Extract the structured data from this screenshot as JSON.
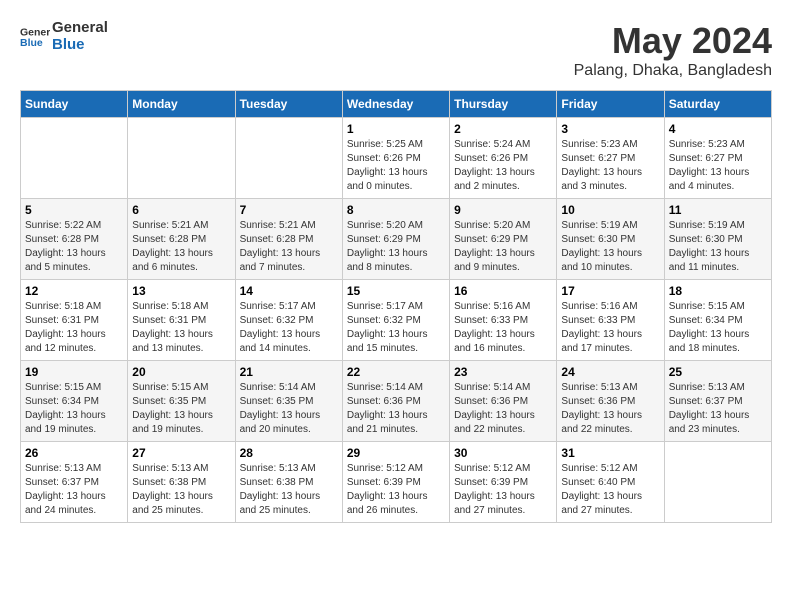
{
  "header": {
    "logo_line1": "General",
    "logo_line2": "Blue",
    "month": "May 2024",
    "location": "Palang, Dhaka, Bangladesh"
  },
  "weekdays": [
    "Sunday",
    "Monday",
    "Tuesday",
    "Wednesday",
    "Thursday",
    "Friday",
    "Saturday"
  ],
  "weeks": [
    [
      {
        "day": "",
        "sunrise": "",
        "sunset": "",
        "daylight": ""
      },
      {
        "day": "",
        "sunrise": "",
        "sunset": "",
        "daylight": ""
      },
      {
        "day": "",
        "sunrise": "",
        "sunset": "",
        "daylight": ""
      },
      {
        "day": "1",
        "sunrise": "Sunrise: 5:25 AM",
        "sunset": "Sunset: 6:26 PM",
        "daylight": "Daylight: 13 hours and 0 minutes."
      },
      {
        "day": "2",
        "sunrise": "Sunrise: 5:24 AM",
        "sunset": "Sunset: 6:26 PM",
        "daylight": "Daylight: 13 hours and 2 minutes."
      },
      {
        "day": "3",
        "sunrise": "Sunrise: 5:23 AM",
        "sunset": "Sunset: 6:27 PM",
        "daylight": "Daylight: 13 hours and 3 minutes."
      },
      {
        "day": "4",
        "sunrise": "Sunrise: 5:23 AM",
        "sunset": "Sunset: 6:27 PM",
        "daylight": "Daylight: 13 hours and 4 minutes."
      }
    ],
    [
      {
        "day": "5",
        "sunrise": "Sunrise: 5:22 AM",
        "sunset": "Sunset: 6:28 PM",
        "daylight": "Daylight: 13 hours and 5 minutes."
      },
      {
        "day": "6",
        "sunrise": "Sunrise: 5:21 AM",
        "sunset": "Sunset: 6:28 PM",
        "daylight": "Daylight: 13 hours and 6 minutes."
      },
      {
        "day": "7",
        "sunrise": "Sunrise: 5:21 AM",
        "sunset": "Sunset: 6:28 PM",
        "daylight": "Daylight: 13 hours and 7 minutes."
      },
      {
        "day": "8",
        "sunrise": "Sunrise: 5:20 AM",
        "sunset": "Sunset: 6:29 PM",
        "daylight": "Daylight: 13 hours and 8 minutes."
      },
      {
        "day": "9",
        "sunrise": "Sunrise: 5:20 AM",
        "sunset": "Sunset: 6:29 PM",
        "daylight": "Daylight: 13 hours and 9 minutes."
      },
      {
        "day": "10",
        "sunrise": "Sunrise: 5:19 AM",
        "sunset": "Sunset: 6:30 PM",
        "daylight": "Daylight: 13 hours and 10 minutes."
      },
      {
        "day": "11",
        "sunrise": "Sunrise: 5:19 AM",
        "sunset": "Sunset: 6:30 PM",
        "daylight": "Daylight: 13 hours and 11 minutes."
      }
    ],
    [
      {
        "day": "12",
        "sunrise": "Sunrise: 5:18 AM",
        "sunset": "Sunset: 6:31 PM",
        "daylight": "Daylight: 13 hours and 12 minutes."
      },
      {
        "day": "13",
        "sunrise": "Sunrise: 5:18 AM",
        "sunset": "Sunset: 6:31 PM",
        "daylight": "Daylight: 13 hours and 13 minutes."
      },
      {
        "day": "14",
        "sunrise": "Sunrise: 5:17 AM",
        "sunset": "Sunset: 6:32 PM",
        "daylight": "Daylight: 13 hours and 14 minutes."
      },
      {
        "day": "15",
        "sunrise": "Sunrise: 5:17 AM",
        "sunset": "Sunset: 6:32 PM",
        "daylight": "Daylight: 13 hours and 15 minutes."
      },
      {
        "day": "16",
        "sunrise": "Sunrise: 5:16 AM",
        "sunset": "Sunset: 6:33 PM",
        "daylight": "Daylight: 13 hours and 16 minutes."
      },
      {
        "day": "17",
        "sunrise": "Sunrise: 5:16 AM",
        "sunset": "Sunset: 6:33 PM",
        "daylight": "Daylight: 13 hours and 17 minutes."
      },
      {
        "day": "18",
        "sunrise": "Sunrise: 5:15 AM",
        "sunset": "Sunset: 6:34 PM",
        "daylight": "Daylight: 13 hours and 18 minutes."
      }
    ],
    [
      {
        "day": "19",
        "sunrise": "Sunrise: 5:15 AM",
        "sunset": "Sunset: 6:34 PM",
        "daylight": "Daylight: 13 hours and 19 minutes."
      },
      {
        "day": "20",
        "sunrise": "Sunrise: 5:15 AM",
        "sunset": "Sunset: 6:35 PM",
        "daylight": "Daylight: 13 hours and 19 minutes."
      },
      {
        "day": "21",
        "sunrise": "Sunrise: 5:14 AM",
        "sunset": "Sunset: 6:35 PM",
        "daylight": "Daylight: 13 hours and 20 minutes."
      },
      {
        "day": "22",
        "sunrise": "Sunrise: 5:14 AM",
        "sunset": "Sunset: 6:36 PM",
        "daylight": "Daylight: 13 hours and 21 minutes."
      },
      {
        "day": "23",
        "sunrise": "Sunrise: 5:14 AM",
        "sunset": "Sunset: 6:36 PM",
        "daylight": "Daylight: 13 hours and 22 minutes."
      },
      {
        "day": "24",
        "sunrise": "Sunrise: 5:13 AM",
        "sunset": "Sunset: 6:36 PM",
        "daylight": "Daylight: 13 hours and 22 minutes."
      },
      {
        "day": "25",
        "sunrise": "Sunrise: 5:13 AM",
        "sunset": "Sunset: 6:37 PM",
        "daylight": "Daylight: 13 hours and 23 minutes."
      }
    ],
    [
      {
        "day": "26",
        "sunrise": "Sunrise: 5:13 AM",
        "sunset": "Sunset: 6:37 PM",
        "daylight": "Daylight: 13 hours and 24 minutes."
      },
      {
        "day": "27",
        "sunrise": "Sunrise: 5:13 AM",
        "sunset": "Sunset: 6:38 PM",
        "daylight": "Daylight: 13 hours and 25 minutes."
      },
      {
        "day": "28",
        "sunrise": "Sunrise: 5:13 AM",
        "sunset": "Sunset: 6:38 PM",
        "daylight": "Daylight: 13 hours and 25 minutes."
      },
      {
        "day": "29",
        "sunrise": "Sunrise: 5:12 AM",
        "sunset": "Sunset: 6:39 PM",
        "daylight": "Daylight: 13 hours and 26 minutes."
      },
      {
        "day": "30",
        "sunrise": "Sunrise: 5:12 AM",
        "sunset": "Sunset: 6:39 PM",
        "daylight": "Daylight: 13 hours and 27 minutes."
      },
      {
        "day": "31",
        "sunrise": "Sunrise: 5:12 AM",
        "sunset": "Sunset: 6:40 PM",
        "daylight": "Daylight: 13 hours and 27 minutes."
      },
      {
        "day": "",
        "sunrise": "",
        "sunset": "",
        "daylight": ""
      }
    ]
  ]
}
